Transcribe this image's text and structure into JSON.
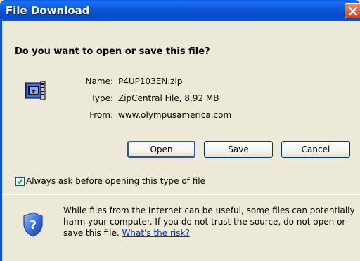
{
  "window": {
    "title": "File Download"
  },
  "dialog": {
    "question": "Do you want to open or save this file?",
    "file": {
      "name_label": "Name:",
      "name_value": "P4UP103EN.zip",
      "type_label": "Type:",
      "type_value": "ZipCentral File, 8.92 MB",
      "from_label": "From:",
      "from_value": "www.olympusamerica.com"
    },
    "buttons": {
      "open": "Open",
      "save": "Save",
      "cancel": "Cancel"
    },
    "always_ask": {
      "label": "Always ask before opening this type of file",
      "checked": true
    },
    "warning": {
      "text": "While files from the Internet can be useful, some files can potentially harm your computer. If you do not trust the source, do not open or save this file.",
      "link": "What's the risk?"
    }
  },
  "icons": {
    "file": "zip-file-icon",
    "warning": "security-shield-icon",
    "close": "close-icon"
  }
}
